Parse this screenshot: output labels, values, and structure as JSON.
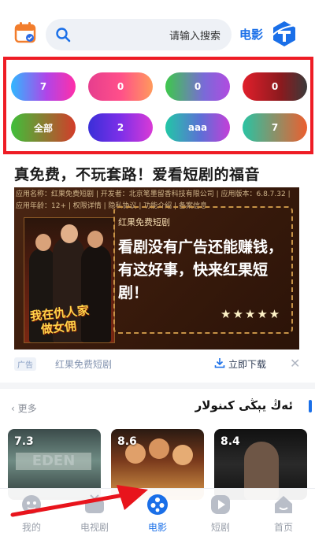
{
  "search": {
    "placeholder": "请输入搜索"
  },
  "header": {
    "category": "电影"
  },
  "filters": [
    {
      "label": "7"
    },
    {
      "label": "0"
    },
    {
      "label": "0"
    },
    {
      "label": "0"
    },
    {
      "label": "全部"
    },
    {
      "label": "2"
    },
    {
      "label": "aaa"
    },
    {
      "label": "7"
    }
  ],
  "ad": {
    "title": "真免费，不玩套路！爱看短剧的福音",
    "meta": "应用名称：红果免费短剧 | 开发者：北京笔墨留香科技有限公司 | 应用版本：6.8.7.32 | 应用年龄：12+ | 权限详情 | 隐私协议 | 功能介绍 | 备案信息",
    "poster_text_1": "我在仇人家",
    "poster_text_2": "做女佣",
    "small": "红果免费短剧",
    "main": "看剧没有广告还能赚钱，有这好事，快来红果短剧！",
    "stars": "★★★★★",
    "tag": "广告",
    "app_name": "红果免费短剧",
    "download": "立即下载",
    "close": "✕"
  },
  "section": {
    "more": "更多",
    "title": "ئەڭ يېڭى كىنولار"
  },
  "movies": [
    {
      "score": "7.3"
    },
    {
      "score": "8.6"
    },
    {
      "score": "8.4"
    }
  ],
  "tabs": [
    {
      "label": "我的"
    },
    {
      "label": "电视剧"
    },
    {
      "label": "电影"
    },
    {
      "label": "短剧"
    },
    {
      "label": "首页"
    }
  ],
  "colors": {
    "accent": "#1a6fe8",
    "highlight_border": "#ee1c25"
  }
}
